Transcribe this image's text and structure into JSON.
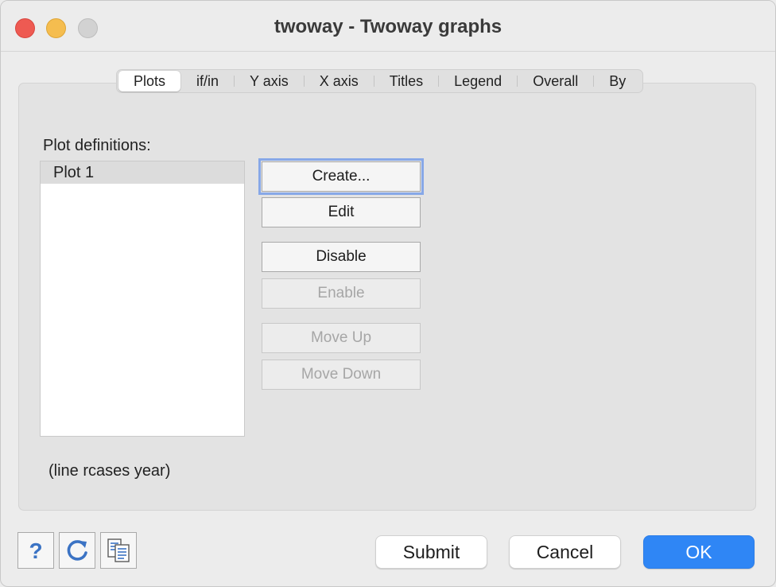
{
  "window": {
    "title": "twoway - Twoway graphs",
    "controls": [
      "close",
      "minimize",
      "maximize"
    ]
  },
  "tabs": [
    {
      "label": "Plots",
      "active": true
    },
    {
      "label": "if/in",
      "active": false
    },
    {
      "label": "Y axis",
      "active": false
    },
    {
      "label": "X axis",
      "active": false
    },
    {
      "label": "Titles",
      "active": false
    },
    {
      "label": "Legend",
      "active": false
    },
    {
      "label": "Overall",
      "active": false
    },
    {
      "label": "By",
      "active": false
    }
  ],
  "plots": {
    "label": "Plot definitions:",
    "items": [
      "Plot 1"
    ],
    "selected": "Plot 1"
  },
  "buttons": {
    "create": "Create...",
    "edit": "Edit",
    "disable": "Disable",
    "enable": "Enable",
    "move_up": "Move Up",
    "move_down": "Move Down"
  },
  "command_preview": "(line rcases year)",
  "footer": {
    "help_icon": "question-mark-icon",
    "reset_icon": "refresh-icon",
    "copy_icon": "copy-command-icon",
    "submit": "Submit",
    "cancel": "Cancel",
    "ok": "OK"
  },
  "colors": {
    "accent": "#2f86f5",
    "focus_ring": "#87a8e8",
    "close": "#ee5a52",
    "minimize": "#f5bd4f",
    "icon_blue": "#3b73c4"
  }
}
